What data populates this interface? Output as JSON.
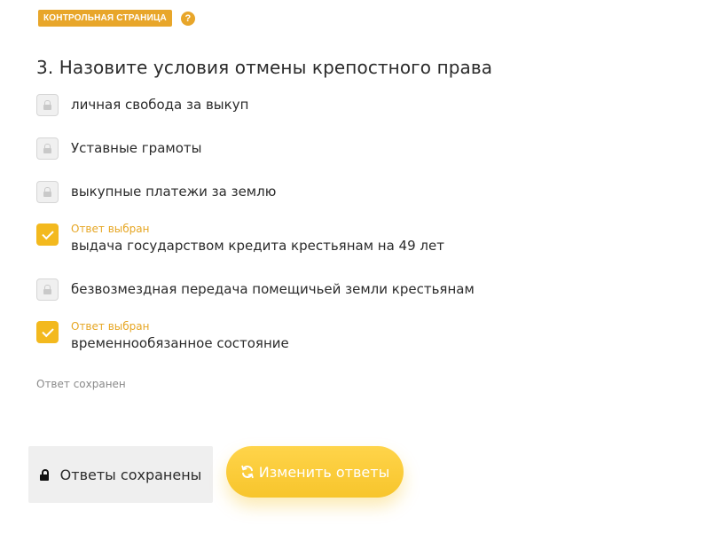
{
  "header": {
    "badge_label": "КОНТРОЛЬНАЯ СТРАНИЦА",
    "help_glyph": "?"
  },
  "question": {
    "title": "3. Назовите условия отмены крепостного права"
  },
  "options": [
    {
      "label": "личная свобода за выкуп",
      "selected": false
    },
    {
      "label": "Уставные грамоты",
      "selected": false
    },
    {
      "label": "выкупные платежи за землю",
      "selected": false
    },
    {
      "label": "выдача государством кредита крестьянам на 49 лет",
      "selected": true,
      "selected_note": "Ответ выбран"
    },
    {
      "label": "безвозмездная передача помещичьей земли крестьянам",
      "selected": false
    },
    {
      "label": "временнообязанное состояние",
      "selected": true,
      "selected_note": "Ответ выбран"
    }
  ],
  "status": {
    "saved_note": "Ответ сохранен"
  },
  "buttons": {
    "saved_label": "Ответы сохранены",
    "change_label": "Изменить ответы"
  },
  "colors": {
    "accent": "#e8a62a",
    "checkbox_checked": "#f3b91e",
    "change_button": "#f7c52c",
    "saved_button_bg": "#efefef"
  },
  "icons": {
    "help": "question-icon",
    "locked_checkbox": "lock-icon",
    "checked_checkbox": "check-icon",
    "saved_button": "lock-icon",
    "change_button": "refresh-icon"
  }
}
